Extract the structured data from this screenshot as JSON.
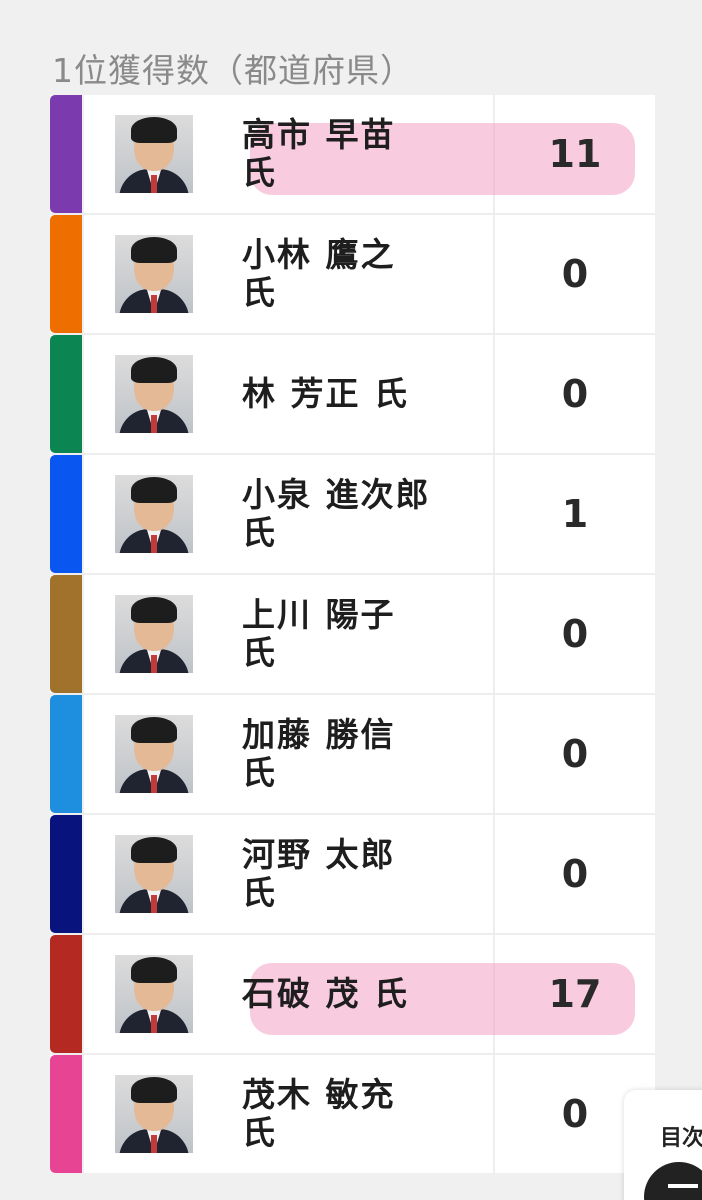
{
  "page": {
    "title": "1位獲得数（都道府県）"
  },
  "candidates": [
    {
      "name": "高市 早苗\n氏",
      "value": "11",
      "color": "#7b3aad",
      "highlight": true
    },
    {
      "name": "小林 鷹之\n氏",
      "value": "0",
      "color": "#ee6f00",
      "highlight": false
    },
    {
      "name": "林 芳正 氏",
      "value": "0",
      "color": "#0b8653",
      "highlight": false
    },
    {
      "name": "小泉 進次郎\n氏",
      "value": "1",
      "color": "#0a56f0",
      "highlight": false
    },
    {
      "name": "上川 陽子\n氏",
      "value": "0",
      "color": "#a0722b",
      "highlight": false
    },
    {
      "name": "加藤 勝信\n氏",
      "value": "0",
      "color": "#1e8fde",
      "highlight": false
    },
    {
      "name": "河野 太郎\n氏",
      "value": "0",
      "color": "#08137e",
      "highlight": false
    },
    {
      "name": "石破 茂 氏",
      "value": "17",
      "color": "#b42a22",
      "highlight": true
    },
    {
      "name": "茂木 敏充\n氏",
      "value": "0",
      "color": "#e84494",
      "highlight": false
    }
  ],
  "toc": {
    "label": "目次"
  }
}
